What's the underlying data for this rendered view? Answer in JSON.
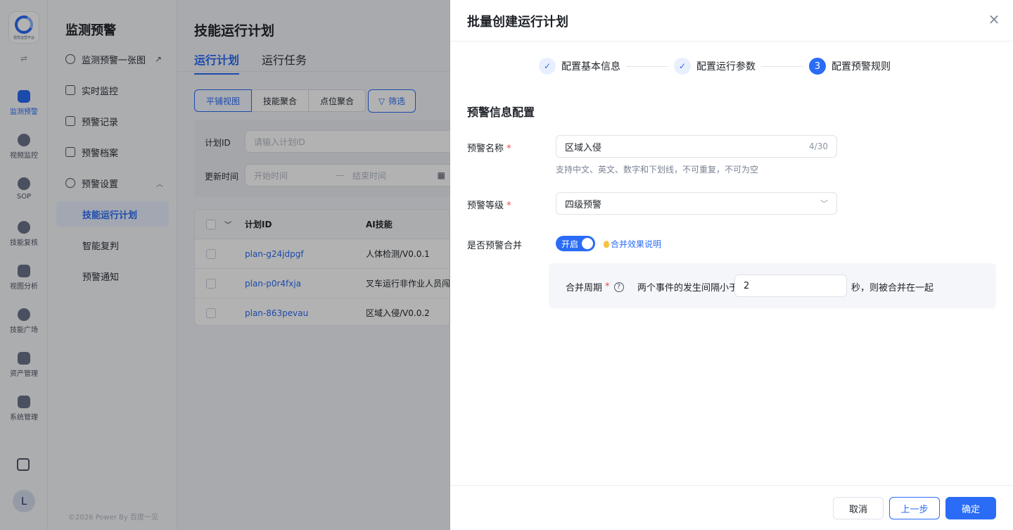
{
  "app": {
    "logo_text": "视觉运营平台",
    "user_initial": "L"
  },
  "rail": {
    "items": [
      {
        "label": "监测预警",
        "icon": "chart-line-icon",
        "active": true
      },
      {
        "label": "视频监控",
        "icon": "camera-icon"
      },
      {
        "label": "SOP",
        "icon": "nodes-icon"
      },
      {
        "label": "技能复核",
        "icon": "hexagon-icon"
      },
      {
        "label": "视图分析",
        "icon": "image-search-icon"
      },
      {
        "label": "技能广场",
        "icon": "cluster-icon"
      },
      {
        "label": "资产管理",
        "icon": "box-icon"
      },
      {
        "label": "系统管理",
        "icon": "settings-panel-icon"
      }
    ]
  },
  "menu": {
    "title": "监测预警",
    "items": [
      {
        "label": "监测预警一张图"
      },
      {
        "label": "实时监控"
      },
      {
        "label": "预警记录"
      },
      {
        "label": "预警档案"
      },
      {
        "label": "预警设置"
      },
      {
        "label": "技能运行计划"
      },
      {
        "label": "智能复判"
      },
      {
        "label": "预警通知"
      }
    ],
    "copyright": "©2026 Power By 百度一见"
  },
  "page": {
    "title": "技能运行计划",
    "tabs": [
      "运行计划",
      "运行任务"
    ],
    "view_modes": [
      "平铺视图",
      "技能聚合",
      "点位聚合"
    ],
    "filter_label": "筛选",
    "filters": {
      "plan_id_label": "计划ID",
      "plan_id_placeholder": "请输入计划ID",
      "update_time_label": "更新时间",
      "start_placeholder": "开始时间",
      "range_sep": "—",
      "end_placeholder": "结束时间"
    },
    "table": {
      "columns": [
        "计划ID",
        "AI技能"
      ],
      "rows": [
        {
          "id": "plan-g24jdpgf",
          "skill": "人体检测/V0.0.1"
        },
        {
          "id": "plan-p0r4fxja",
          "skill": "叉车运行非作业人员闯"
        },
        {
          "id": "plan-863pevau",
          "skill": "区域入侵/V0.0.2"
        }
      ]
    }
  },
  "drawer": {
    "title": "批量创建运行计划",
    "close": "×",
    "steps": [
      {
        "label": "配置基本信息",
        "marker": "✓"
      },
      {
        "label": "配置运行参数",
        "marker": "✓"
      },
      {
        "label": "配置预警规则",
        "marker": "3"
      }
    ],
    "section_title": "预警信息配置",
    "name_label": "预警名称",
    "name_value": "区域入侵",
    "name_count": "4/30",
    "name_hint": "支持中文、英文、数字和下划线，不可重复，不可为空",
    "level_label": "预警等级",
    "level_value": "四级预警",
    "merge_label": "是否预警合并",
    "merge_toggle": "开启",
    "merge_help_link": "合并效果说明",
    "period_label": "合并周期",
    "period_text": "两个事件的发生间隔小于",
    "period_value": "2",
    "period_suffix": "秒，则被合并在一起",
    "required_mark": "*",
    "help_mark": "?",
    "buttons": {
      "cancel": "取消",
      "prev": "上一步",
      "ok": "确定"
    }
  }
}
